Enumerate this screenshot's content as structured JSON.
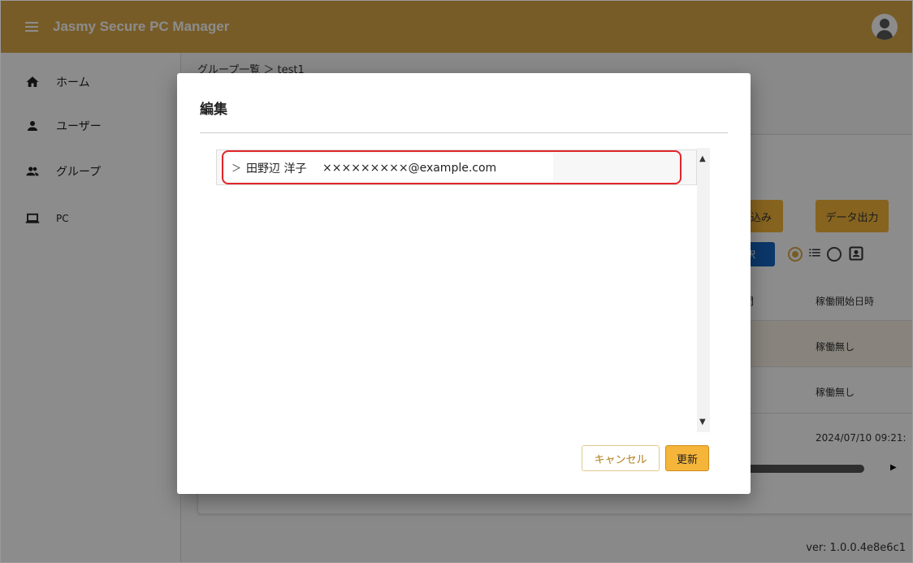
{
  "app": {
    "title": "Jasmy Secure PC Manager"
  },
  "sidebar": {
    "items": [
      {
        "label": "ホーム",
        "icon": "home-icon"
      },
      {
        "label": "ユーザー",
        "icon": "person-icon"
      },
      {
        "label": "グループ",
        "icon": "group-icon"
      },
      {
        "label": "PC",
        "icon": "laptop-icon"
      }
    ]
  },
  "main": {
    "breadcrumb": "グループ一覧 ＞ test1",
    "buttons": {
      "import_partial": "読み込み",
      "export": "データ出力",
      "select_partial": "選択"
    },
    "table": {
      "headers": [
        "時間",
        "稼働開始日時"
      ],
      "rows": [
        "稼働無し",
        "稼働無し",
        "2024/07/10 09:21:"
      ]
    },
    "version": "ver: 1.0.0.4e8e6c1"
  },
  "dialog": {
    "title": "編集",
    "tree_items": [
      {
        "name": "田野辺 洋子",
        "email": "×××××××××@example.com"
      }
    ],
    "cancel_label": "キャンセル",
    "update_label": "更新"
  },
  "colors": {
    "appbar": "#d9a84a",
    "accent": "#f5b53a",
    "highlight": "#e0262a"
  }
}
